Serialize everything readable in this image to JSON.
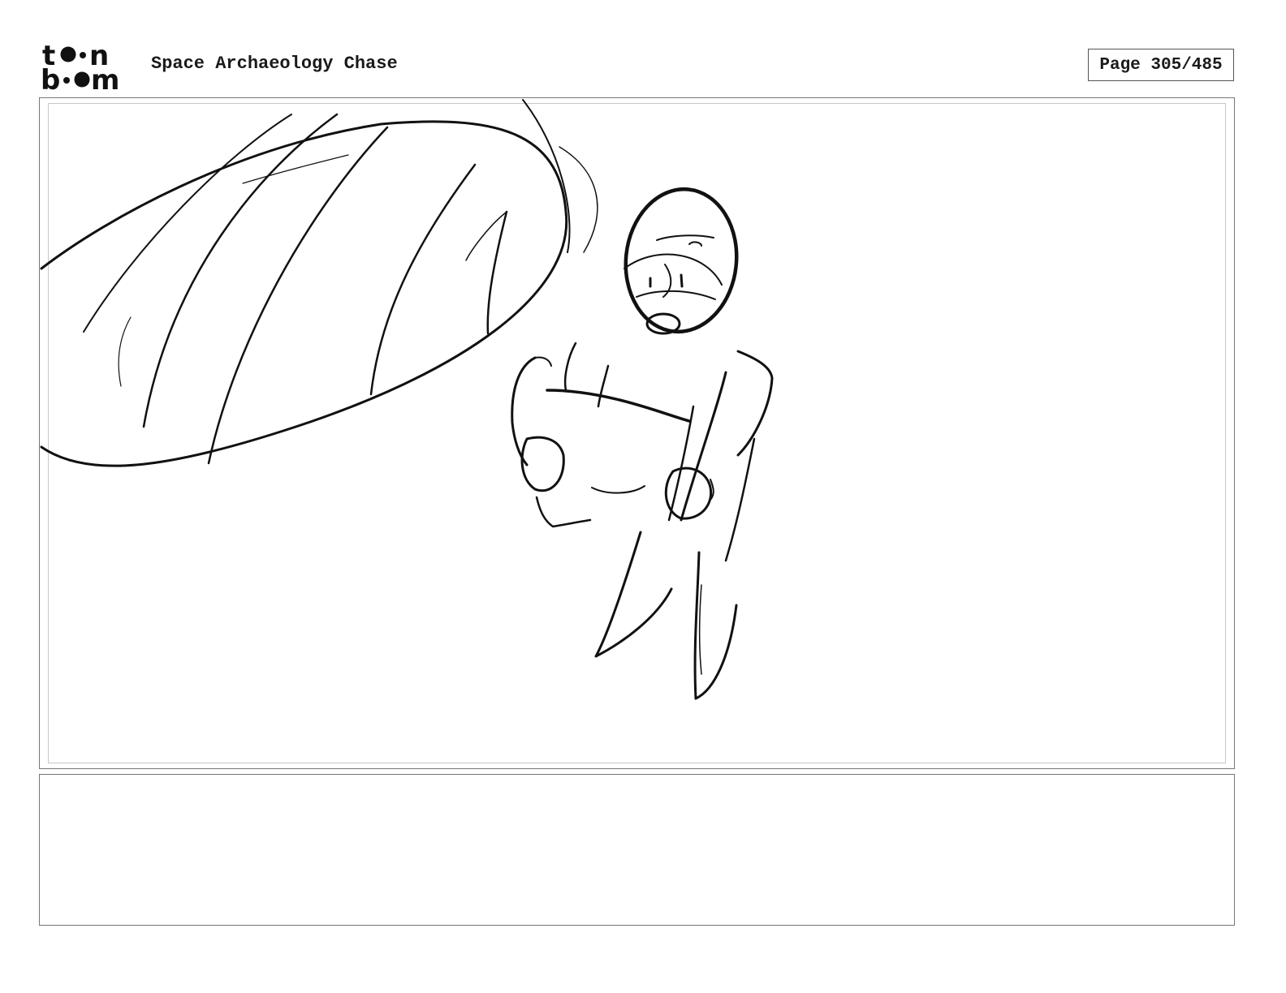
{
  "header": {
    "logo_text": "toonboom",
    "project_title": "Space Archaeology Chase",
    "page_label": "Page 305/485"
  },
  "panel": {
    "caption": ""
  }
}
